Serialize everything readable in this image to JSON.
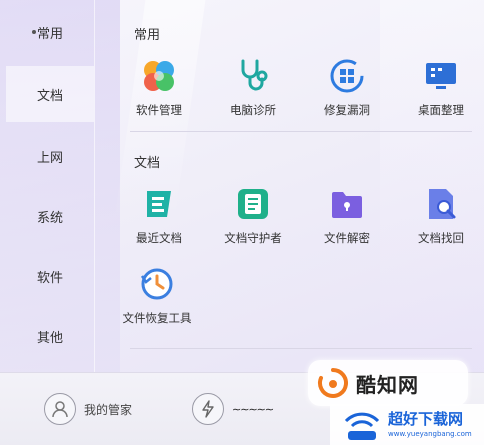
{
  "sidebar": {
    "items": [
      {
        "label": "常用",
        "active": true
      },
      {
        "label": "文档"
      },
      {
        "label": "上网"
      },
      {
        "label": "系统"
      },
      {
        "label": "软件"
      },
      {
        "label": "其他"
      }
    ]
  },
  "sections": [
    {
      "title": "常用",
      "tiles": [
        {
          "label": "软件管理",
          "icon": "software-manager-icon"
        },
        {
          "label": "电脑诊所",
          "icon": "stethoscope-icon"
        },
        {
          "label": "修复漏洞",
          "icon": "windows-repair-icon"
        },
        {
          "label": "桌面整理",
          "icon": "desktop-organize-icon"
        }
      ]
    },
    {
      "title": "文档",
      "tiles": [
        {
          "label": "最近文档",
          "icon": "recent-docs-icon"
        },
        {
          "label": "文档守护者",
          "icon": "doc-guardian-icon"
        },
        {
          "label": "文件解密",
          "icon": "file-decrypt-icon"
        },
        {
          "label": "文档找回",
          "icon": "doc-recover-icon"
        },
        {
          "label": "文件恢复工具",
          "icon": "file-restore-clock-icon"
        }
      ]
    }
  ],
  "footer": {
    "manager_label": "我的管家",
    "speed_label": "~~~~~",
    "icons": [
      "user-avatar-icon",
      "lightning-icon"
    ]
  },
  "watermark": {
    "logo_text": "酷知网",
    "site_name": "超好下载网",
    "site_url": "www.yueyangbang.com"
  },
  "colors": {
    "accent_blue": "#2d7be0",
    "teal": "#1fa7a0",
    "purple": "#7b5fe0",
    "panel_bg": "#efedf8"
  }
}
